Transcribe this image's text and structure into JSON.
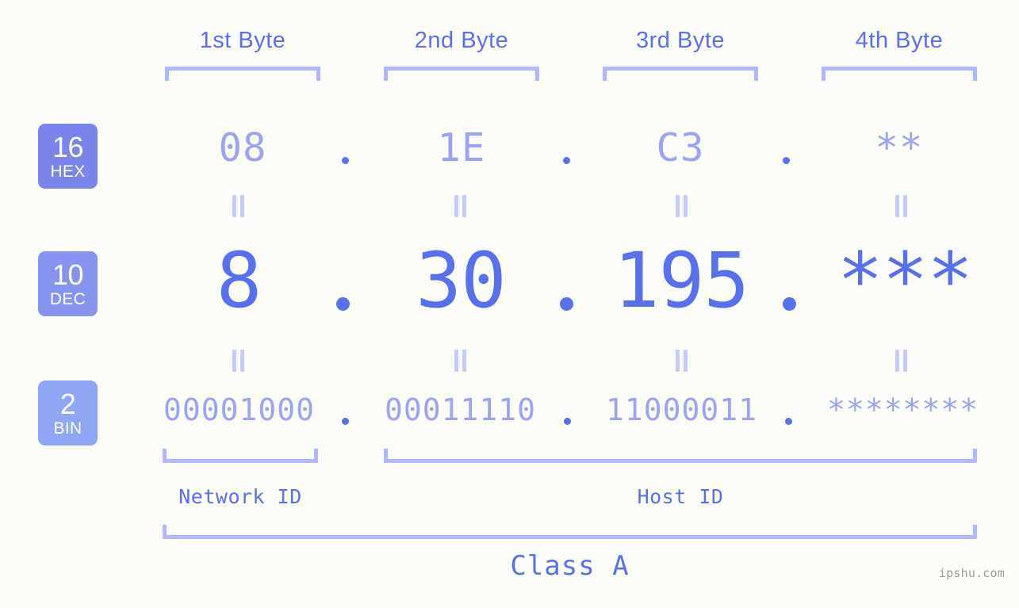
{
  "background_color": "#fcfdf8",
  "accent_color": "#5870ee",
  "muted_accent_color": "#9aa4f2",
  "bracket_color": "#aeb8fb",
  "byte_headers": [
    {
      "label": "1st Byte"
    },
    {
      "label": "2nd Byte"
    },
    {
      "label": "3rd Byte"
    },
    {
      "label": "4th Byte"
    }
  ],
  "base_badges": [
    {
      "num": "16",
      "abbr": "HEX",
      "color": "#7b84e8"
    },
    {
      "num": "10",
      "abbr": "DEC",
      "color": "#8793f0"
    },
    {
      "num": "2",
      "abbr": "BIN",
      "color": "#8fa6f5"
    }
  ],
  "rows": {
    "hex": {
      "values": [
        "08",
        "1E",
        "C3",
        "**"
      ],
      "separator": "."
    },
    "dec": {
      "values": [
        "8",
        "30",
        "195",
        "***"
      ],
      "separator": "."
    },
    "bin": {
      "values": [
        "00001000",
        "00011110",
        "11000011",
        "********"
      ],
      "separator": "."
    }
  },
  "equals_sign": "=",
  "id_labels": [
    {
      "label": "Network ID"
    },
    {
      "label": "Host ID"
    }
  ],
  "class_label": "Class A",
  "watermark": "ipshu.com"
}
